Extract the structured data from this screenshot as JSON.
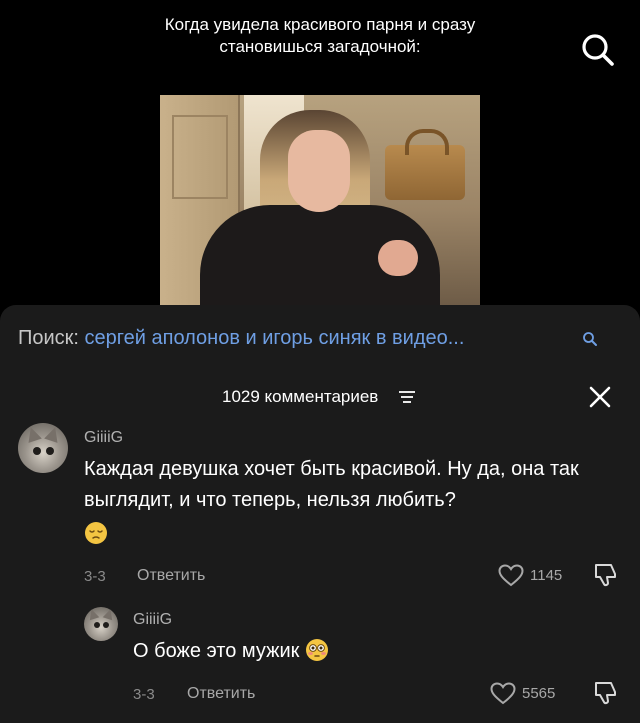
{
  "video": {
    "caption": "Когда увидела красивого парня и сразу становишься загадочной:"
  },
  "related_search": {
    "label": "Поиск:",
    "query": "сергей аполонов и игорь синяк в видео..."
  },
  "comments": {
    "count_label": "1029 комментариев"
  },
  "comment_1": {
    "username": "GiiiiG",
    "text": "Каждая девушка хочет быть красивой. Ну да, она так выглядит, и что теперь, нельзя любить?",
    "emoji": "pensive-face",
    "date": "3-3",
    "reply_label": "Ответить",
    "likes": "1145"
  },
  "comment_2": {
    "username": "GiiiiG",
    "text": "О боже это мужик",
    "emoji": "flushed-face",
    "date": "3-3",
    "reply_label": "Ответить",
    "likes": "5565"
  },
  "colors": {
    "background": "#000000",
    "sheet": "#1b1b1b",
    "link": "#6f9fe4",
    "emoji": "#f4c542"
  }
}
